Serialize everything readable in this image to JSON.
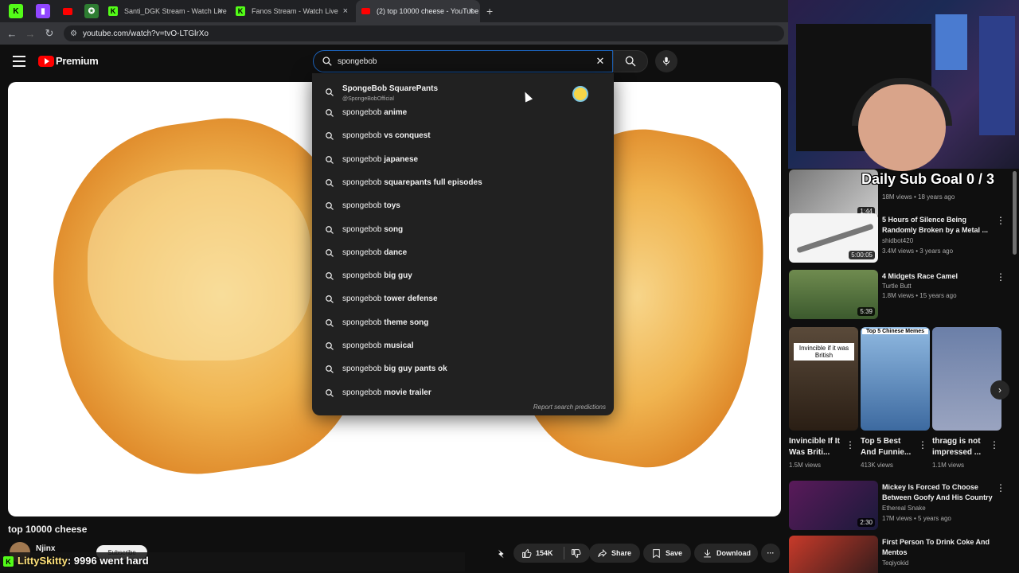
{
  "browser": {
    "tabs": [
      {
        "title": "Santi_DGK Stream - Watch Live",
        "close": "×"
      },
      {
        "title": "Fanos Stream - Watch Live on Kick",
        "close": "×"
      },
      {
        "title": "(2) top 10000 cheese - YouTube",
        "close": "×"
      }
    ],
    "new_tab": "+",
    "url": "youtube.com/watch?v=tvO-LTGlrXo"
  },
  "header": {
    "logo_text": "Premium",
    "search_value": "spongebob",
    "clear": "✕"
  },
  "suggestions": {
    "channel": {
      "title": "SpongeBob SquarePants",
      "handle": "@SpongeBobOfficial"
    },
    "items": [
      {
        "prefix": "spongebob ",
        "rest": "anime"
      },
      {
        "prefix": "spongebob ",
        "rest": "vs conquest"
      },
      {
        "prefix": "spongebob ",
        "rest": "japanese"
      },
      {
        "prefix": "spongebob ",
        "rest": "squarepants full episodes"
      },
      {
        "prefix": "spongebob ",
        "rest": "toys"
      },
      {
        "prefix": "spongebob ",
        "rest": "song"
      },
      {
        "prefix": "spongebob ",
        "rest": "dance"
      },
      {
        "prefix": "spongebob ",
        "rest": "big guy"
      },
      {
        "prefix": "spongebob ",
        "rest": "tower defense"
      },
      {
        "prefix": "spongebob ",
        "rest": "theme song"
      },
      {
        "prefix": "spongebob ",
        "rest": "musical"
      },
      {
        "prefix": "spongebob ",
        "rest": "big guy pants ok"
      },
      {
        "prefix": "spongebob ",
        "rest": "movie trailer"
      }
    ],
    "report": "Report search predictions"
  },
  "video": {
    "title": "top 10000 cheese",
    "channel": "Njinx",
    "subscribe": "Subscribe",
    "likes": "154K",
    "share": "Share",
    "save": "Save",
    "download": "Download",
    "more": "···"
  },
  "chat": {
    "user": "LittySkitty",
    "message": ": 9996 went hard"
  },
  "overlay": {
    "sub_goal": "Daily Sub Goal  0 / 3"
  },
  "recommendations": [
    {
      "title": "",
      "channel": "",
      "meta": "18M views • 18 years ago",
      "duration": "1:44"
    },
    {
      "title": "5 Hours of Silence Being Randomly Broken by a Metal ...",
      "channel": "shidbot420",
      "meta": "3.4M views • 3 years ago",
      "duration": "5:00:05"
    },
    {
      "title": "4 Midgets Race Camel",
      "channel": "Turtle Butt",
      "meta": "1.8M views • 15 years ago",
      "duration": "5:39"
    },
    {
      "title": "Mickey Is Forced To Choose Between Goofy And His Country",
      "channel": "Ethereal Snake",
      "meta": "17M views • 5 years ago",
      "duration": "2:30"
    },
    {
      "title": "First Person To Drink Coke And Mentos",
      "channel": "Teqiyokid",
      "meta": "",
      "duration": ""
    }
  ],
  "shorts": [
    {
      "title": "Invincible If It Was Briti...",
      "views": "1.5M views",
      "thumb_text": "Invincible if it was British"
    },
    {
      "title": "Top 5 Best And Funnie...",
      "views": "413K views",
      "thumb_text": "Top 5 Chinese Memes"
    },
    {
      "title": "thragg is not impressed ...",
      "views": "1.1M views",
      "thumb_text": ""
    }
  ],
  "icons": {
    "kick_letter": "K",
    "back": "←",
    "forward": "→",
    "reload": "↻",
    "kebab": "⋮",
    "next": "›"
  }
}
